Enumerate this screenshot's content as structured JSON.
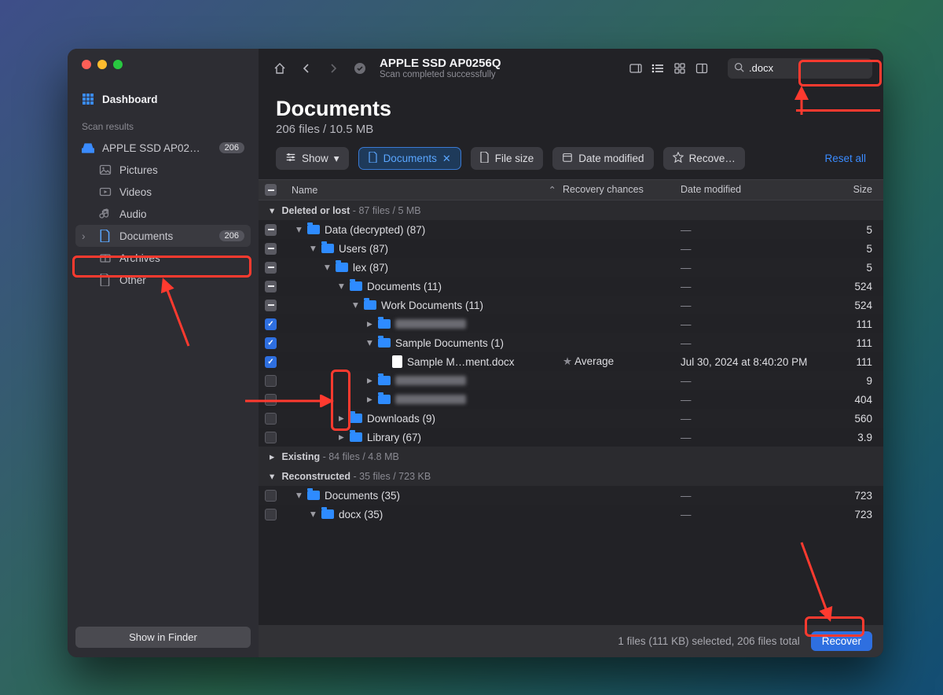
{
  "window": {
    "traffic_colors": [
      "#ff5f57",
      "#febc2e",
      "#28c840"
    ]
  },
  "sidebar": {
    "dashboard_label": "Dashboard",
    "scan_results_label": "Scan results",
    "disk": {
      "label": "APPLE SSD AP02…",
      "badge": "206"
    },
    "items": [
      {
        "label": "Pictures"
      },
      {
        "label": "Videos"
      },
      {
        "label": "Audio"
      },
      {
        "label": "Documents",
        "badge": "206",
        "active": true
      },
      {
        "label": "Archives"
      },
      {
        "label": "Other"
      }
    ],
    "show_in_finder_label": "Show in Finder"
  },
  "toolbar": {
    "title": "APPLE SSD AP0256Q",
    "subtitle": "Scan completed successfully",
    "search_value": ".docx"
  },
  "header": {
    "title": "Documents",
    "subtitle": "206 files / 10.5 MB"
  },
  "filters": {
    "show_label": "Show",
    "documents_label": "Documents",
    "file_size_label": "File size",
    "date_modified_label": "Date modified",
    "recovery_label": "Recove…",
    "reset_label": "Reset all"
  },
  "columns": {
    "name": "Name",
    "recovery": "Recovery chances",
    "date": "Date modified",
    "size": "Size"
  },
  "sections": {
    "deleted_prefix": "Deleted or lost",
    "deleted_stats": "87 files / 5 MB",
    "existing_prefix": "Existing",
    "existing_stats": "84 files / 4.8 MB",
    "reconstructed_prefix": "Reconstructed",
    "reconstructed_stats": "35 files / 723 KB"
  },
  "rows": [
    {
      "indent": 0,
      "chk": "minus",
      "disc": "down",
      "icon": "folder",
      "name": "Data (decrypted) (87)",
      "rec": "",
      "date": "—",
      "size": "5"
    },
    {
      "indent": 1,
      "chk": "minus",
      "disc": "down",
      "icon": "folder",
      "name": "Users (87)",
      "rec": "",
      "date": "—",
      "size": "5"
    },
    {
      "indent": 2,
      "chk": "minus",
      "disc": "down",
      "icon": "folder",
      "name": "lex (87)",
      "rec": "",
      "date": "—",
      "size": "5"
    },
    {
      "indent": 3,
      "chk": "minus",
      "disc": "down",
      "icon": "folder",
      "name": "Documents (11)",
      "rec": "",
      "date": "—",
      "size": "524"
    },
    {
      "indent": 4,
      "chk": "minus",
      "disc": "down",
      "icon": "folder",
      "name": "Work Documents (11)",
      "rec": "",
      "date": "—",
      "size": "524"
    },
    {
      "indent": 5,
      "chk": "yes",
      "disc": "right",
      "icon": "folder",
      "name": "__blur__",
      "rec": "",
      "date": "—",
      "size": "111"
    },
    {
      "indent": 5,
      "chk": "yes",
      "disc": "down",
      "icon": "folder",
      "name": "Sample Documents (1)",
      "rec": "",
      "date": "—",
      "size": "111"
    },
    {
      "indent": 6,
      "chk": "yes",
      "disc": "",
      "icon": "file",
      "name": "Sample M…ment.docx",
      "rec": "Average",
      "date": "Jul 30, 2024 at 8:40:20 PM",
      "size": "111"
    },
    {
      "indent": 5,
      "chk": "empty",
      "disc": "right",
      "icon": "folder",
      "name": "__blur__",
      "rec": "",
      "date": "—",
      "size": "9"
    },
    {
      "indent": 5,
      "chk": "empty",
      "disc": "right",
      "icon": "folder",
      "name": "__blur__",
      "rec": "",
      "date": "—",
      "size": "404"
    },
    {
      "indent": 3,
      "chk": "empty",
      "disc": "right",
      "icon": "folder",
      "name": "Downloads (9)",
      "rec": "",
      "date": "—",
      "size": "560"
    },
    {
      "indent": 3,
      "chk": "empty",
      "disc": "right",
      "icon": "folder",
      "name": "Library (67)",
      "rec": "",
      "date": "—",
      "size": "3.9"
    }
  ],
  "recon_rows": [
    {
      "indent": 0,
      "chk": "empty",
      "disc": "down",
      "icon": "folder",
      "name": "Documents (35)",
      "date": "—",
      "size": "723"
    },
    {
      "indent": 1,
      "chk": "empty",
      "disc": "down",
      "icon": "folder",
      "name": "docx (35)",
      "date": "—",
      "size": "723"
    }
  ],
  "footer": {
    "status": "1 files (111 KB) selected, 206 files total",
    "recover_label": "Recover"
  }
}
